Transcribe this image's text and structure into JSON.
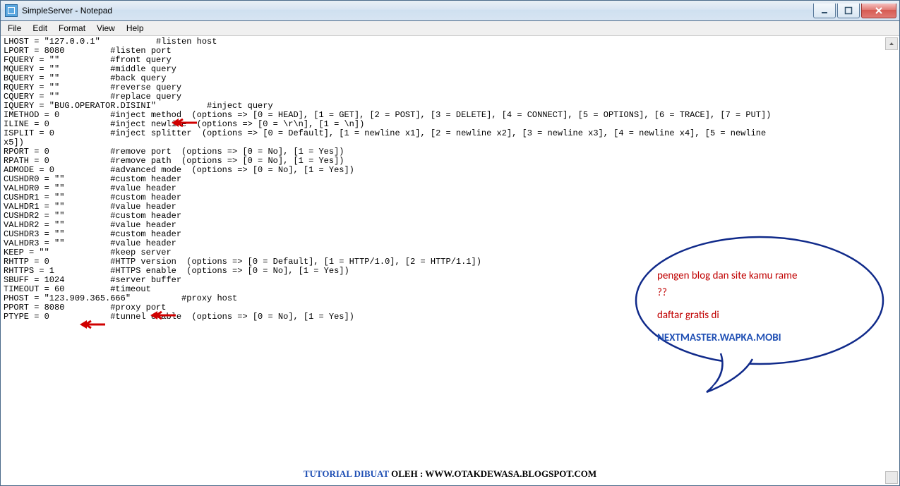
{
  "window": {
    "title": "SimpleServer - Notepad"
  },
  "menubar": {
    "items": [
      "File",
      "Edit",
      "Format",
      "View",
      "Help"
    ]
  },
  "editor": {
    "text": "LHOST = \"127.0.0.1\"           #listen host\nLPORT = 8080         #listen port\nFQUERY = \"\"          #front query\nMQUERY = \"\"          #middle query\nBQUERY = \"\"          #back query\nRQUERY = \"\"          #reverse query\nCQUERY = \"\"          #replace query\nIQUERY = \"BUG.OPERATOR.DISINI\"          #inject query\nIMETHOD = 0          #inject method  (options => [0 = HEAD], [1 = GET], [2 = POST], [3 = DELETE], [4 = CONNECT], [5 = OPTIONS], [6 = TRACE], [7 = PUT])\nILINE = 0            #inject newline  (options => [0 = \\r\\n], [1 = \\n])\nISPLIT = 0           #inject splitter  (options => [0 = Default], [1 = newline x1], [2 = newline x2], [3 = newline x3], [4 = newline x4], [5 = newline\nx5])\nRPORT = 0            #remove port  (options => [0 = No], [1 = Yes])\nRPATH = 0            #remove path  (options => [0 = No], [1 = Yes])\nADMODE = 0           #advanced mode  (options => [0 = No], [1 = Yes])\nCUSHDR0 = \"\"         #custom header\nVALHDR0 = \"\"         #value header\nCUSHDR1 = \"\"         #custom header\nVALHDR1 = \"\"         #value header\nCUSHDR2 = \"\"         #custom header\nVALHDR2 = \"\"         #value header\nCUSHDR3 = \"\"         #custom header\nVALHDR3 = \"\"         #value header\nKEEP = \"\"            #keep server\nRHTTP = 0            #HTTP version  (options => [0 = Default], [1 = HTTP/1.0], [2 = HTTP/1.1])\nRHTTPS = 1           #HTTPS enable  (options => [0 = No], [1 = Yes])\nSBUFF = 1024         #server buffer\nTIMEOUT = 60         #timeout\nPHOST = \"123.909.365.666\"          #proxy host\nPPORT = 8080         #proxy port\nPTYPE = 0            #tunnel enable  (options => [0 = No], [1 = Yes])"
  },
  "bubble": {
    "line1": "pengen blog dan site kamu rame",
    "line2": "??",
    "line3": "daftar gratis di",
    "link": "NEXTMASTER.WAPKA.MOBI"
  },
  "footer": {
    "label": "TUTORIAL DIBUAT",
    "rest": " OLEH : WWW.OTAKDEWASA.BLOGSPOT.COM"
  },
  "arrows": {
    "color": "#d00000"
  }
}
